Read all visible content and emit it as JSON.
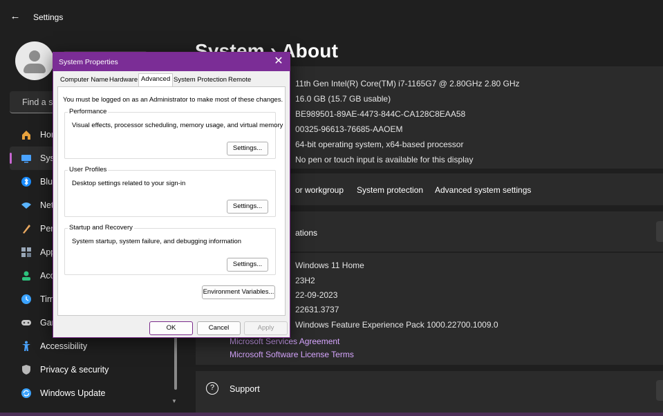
{
  "window": {
    "title": "Settings",
    "back_icon": "arrow-left-icon"
  },
  "sidebar": {
    "search_placeholder": "Find a se",
    "items": [
      {
        "label": "Hor",
        "icon": "home-icon",
        "color": "#e8a23d"
      },
      {
        "label": "Sys",
        "icon": "system-icon",
        "color": "#4aa3ff",
        "active": true
      },
      {
        "label": "Blu",
        "icon": "bluetooth-icon",
        "color": "#1a8cff"
      },
      {
        "label": "Net",
        "icon": "network-icon",
        "color": "#5ab4ff"
      },
      {
        "label": "Per",
        "icon": "personalization-icon",
        "color": "#e8a860"
      },
      {
        "label": "App",
        "icon": "apps-icon",
        "color": "#9aa8b8"
      },
      {
        "label": "Acc",
        "icon": "accounts-icon",
        "color": "#2ec27e"
      },
      {
        "label": "Tim",
        "icon": "time-language-icon",
        "color": "#3ba3ff"
      },
      {
        "label": "Gar",
        "icon": "gaming-icon",
        "color": "#c9c9c9"
      },
      {
        "label": "Accessibility",
        "icon": "accessibility-icon",
        "color": "#4aa3ff"
      },
      {
        "label": "Privacy & security",
        "icon": "shield-icon",
        "color": "#b8b8b8"
      },
      {
        "label": "Windows Update",
        "icon": "update-icon",
        "color": "#3ba3ff"
      }
    ]
  },
  "main": {
    "heading": "System  ›  About",
    "specs": [
      "11th Gen Intel(R) Core(TM) i7-1165G7 @ 2.80GHz   2.80 GHz",
      "16.0 GB (15.7 GB usable)",
      "BE989501-89AE-4473-844C-CA128C8EAA58",
      "00325-96613-76685-AAOEM",
      "64-bit operating system, x64-based processor",
      "No pen or touch input is available for this display"
    ],
    "related_links": {
      "domain": "or workgroup",
      "protection": "System protection",
      "advanced": "Advanced system settings"
    },
    "windows_spec_title": "ations",
    "windows_specs": [
      "Windows 11 Home",
      "23H2",
      "22-09-2023",
      "22631.3737",
      "Windows Feature Experience Pack 1000.22700.1009.0"
    ],
    "ms_links": {
      "services": "Microsoft Services Agreement",
      "license": "Microsoft Software License Terms"
    },
    "support": {
      "title": "Support",
      "icon": "question-icon"
    }
  },
  "dialog": {
    "title": "System Properties",
    "tabs": [
      "Computer Name",
      "Hardware",
      "Advanced",
      "System Protection",
      "Remote"
    ],
    "active_tab": "Advanced",
    "admin_note": "You must be logged on as an Administrator to make most of these changes.",
    "performance": {
      "label": "Performance",
      "desc": "Visual effects, processor scheduling, memory usage, and virtual memory",
      "button": "Settings..."
    },
    "user_profiles": {
      "label": "User Profiles",
      "desc": "Desktop settings related to your sign-in",
      "button": "Settings..."
    },
    "startup": {
      "label": "Startup and Recovery",
      "desc": "System startup, system failure, and debugging information",
      "button": "Settings..."
    },
    "env_button": "Environment Variables...",
    "ok": "OK",
    "cancel": "Cancel",
    "apply": "Apply"
  }
}
